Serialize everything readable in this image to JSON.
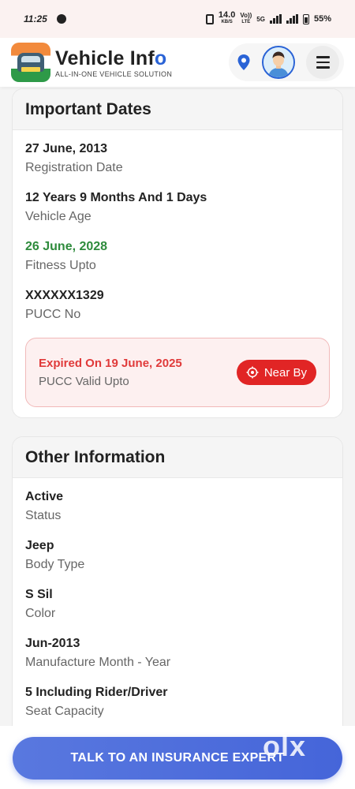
{
  "status_bar": {
    "time": "11:25",
    "speed_value": "14.0",
    "speed_unit": "KB/S",
    "network": "Vo))",
    "network_sub": "LTE",
    "gen": "5G",
    "battery": "55%"
  },
  "header": {
    "brand_main": "Vehicle Inf",
    "brand_accent": "o",
    "brand_tagline": "ALL-IN-ONE VEHICLE SOLUTION"
  },
  "important_dates": {
    "title": "Important Dates",
    "rows": [
      {
        "value": "27 June, 2013",
        "label": "Registration Date"
      },
      {
        "value": "12 Years 9 Months And 1 Days",
        "label": "Vehicle Age"
      },
      {
        "value": "26 June, 2028",
        "label": "Fitness Upto"
      },
      {
        "value": "XXXXXX1329",
        "label": "PUCC No"
      }
    ],
    "pucc": {
      "expired_text": "Expired On 19 June, 2025",
      "label": "PUCC Valid Upto",
      "button_label": "Near By"
    }
  },
  "other_information": {
    "title": "Other Information",
    "rows": [
      {
        "value": "Active",
        "label": "Status"
      },
      {
        "value": "Jeep",
        "label": "Body Type"
      },
      {
        "value": "S Sil",
        "label": "Color"
      },
      {
        "value": "Jun-2013",
        "label": "Manufacture Month - Year"
      },
      {
        "value": "5 Including Rider/Driver",
        "label": "Seat Capacity"
      }
    ]
  },
  "cta": {
    "label": "TALK TO AN INSURANCE EXPERT"
  },
  "watermark": "olx",
  "colors": {
    "accent_blue": "#2a63d6",
    "fitness_green": "#2e8b3c",
    "expired_red": "#e03a3a",
    "nearby_red": "#e12525",
    "cta_blue": "#4f6fdc"
  }
}
